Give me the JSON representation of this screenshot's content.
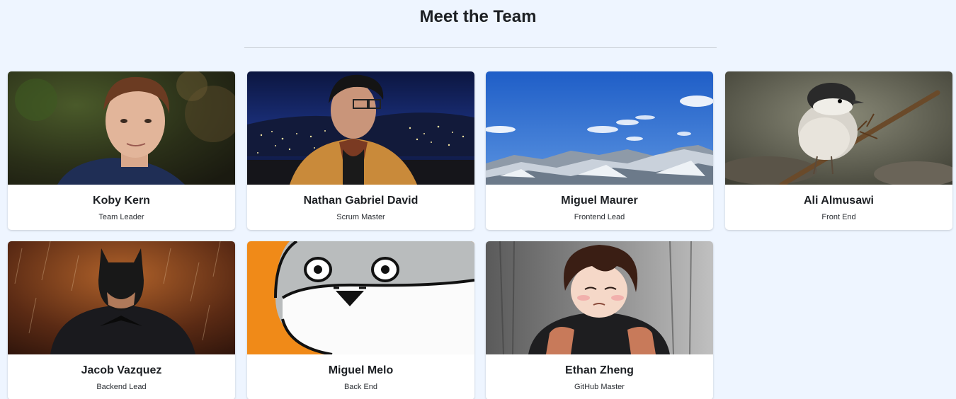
{
  "page": {
    "title": "Meet the Team"
  },
  "members": [
    {
      "name": "Koby Kern",
      "role": "Team Leader",
      "photo_icon": "portrait-photo"
    },
    {
      "name": "Nathan Gabriel David",
      "role": "Scrum Master",
      "photo_icon": "night-city-portrait-photo"
    },
    {
      "name": "Miguel Maurer",
      "role": "Frontend Lead",
      "photo_icon": "mountain-landscape-photo"
    },
    {
      "name": "Ali Almusawi",
      "role": "Front End",
      "photo_icon": "bird-photo"
    },
    {
      "name": "Jacob Vazquez",
      "role": "Backend Lead",
      "photo_icon": "batman-photo"
    },
    {
      "name": "Miguel Melo",
      "role": "Back End",
      "photo_icon": "cartoon-creature-photo"
    },
    {
      "name": "Ethan Zheng",
      "role": "GitHub Master",
      "photo_icon": "anime-character-photo"
    }
  ],
  "colors": {
    "background": "#eef5ff",
    "card": "#ffffff",
    "divider": "#c8ced6"
  }
}
